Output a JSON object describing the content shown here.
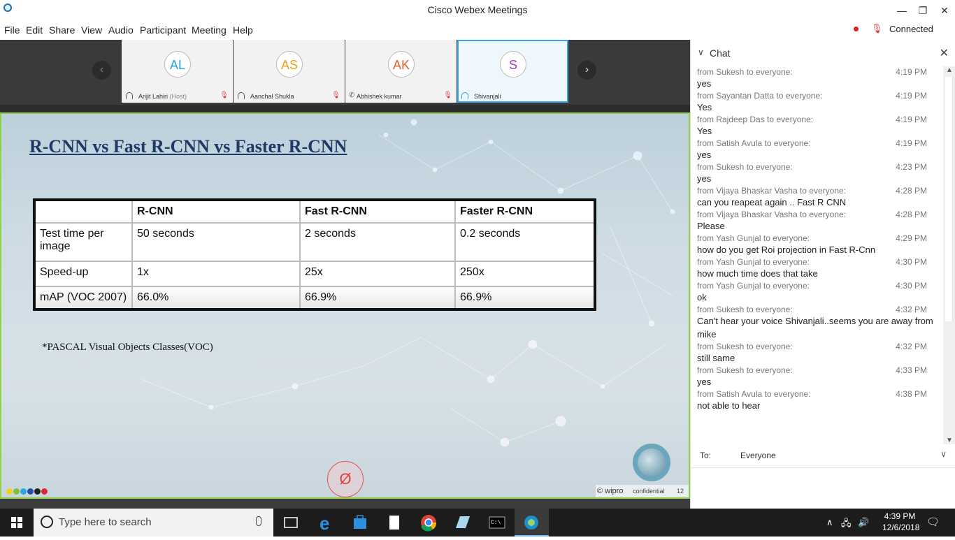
{
  "window": {
    "title": "Cisco Webex Meetings",
    "minimize": "—",
    "restore": "❐",
    "close": "✕"
  },
  "menu": [
    "File",
    "Edit",
    "Share",
    "View",
    "Audio",
    "Participant",
    "Meeting",
    "Help"
  ],
  "status": {
    "connection": "Connected",
    "recording_color": "#e02020"
  },
  "participants": [
    {
      "initials": "AL",
      "name": "Arijit Lahiri",
      "role": "(Host)",
      "color": "#2a9fd8"
    },
    {
      "initials": "AS",
      "name": "Aanchal Shukla",
      "role": "",
      "color": "#e8a21a"
    },
    {
      "initials": "AK",
      "name": "Abhishek kumar",
      "role": "",
      "color": "#e0612a"
    },
    {
      "initials": "S",
      "name": "Shivanjali",
      "role": "",
      "color": "#9b3fb5"
    }
  ],
  "slide": {
    "title": "R-CNN vs Fast R-CNN vs Faster R-CNN",
    "table": {
      "headers": [
        "",
        "R-CNN",
        "Fast R-CNN",
        "Faster R-CNN"
      ],
      "rows": [
        [
          "Test time per image",
          "50 seconds",
          "2 seconds",
          "0.2 seconds"
        ],
        [
          "Speed-up",
          "1x",
          "25x",
          "250x"
        ],
        [
          "mAP (VOC 2007)",
          "66.0%",
          "66.9%",
          "66.9%"
        ]
      ]
    },
    "note": "*PASCAL Visual Objects Classes(VOC)",
    "footer_brand": "© wipro",
    "footer_label": "confidential",
    "page_number": "12"
  },
  "chat": {
    "title": "Chat",
    "to_label": "To:",
    "to_value": "Everyone",
    "messages": [
      {
        "from": "from Sukesh to everyone:",
        "time": "4:19 PM",
        "text": "yes"
      },
      {
        "from": "from Sayantan Datta to everyone:",
        "time": "4:19 PM",
        "text": "Yes"
      },
      {
        "from": "from Rajdeep Das to everyone:",
        "time": "4:19 PM",
        "text": "Yes"
      },
      {
        "from": "from Satish Avula to everyone:",
        "time": "4:19 PM",
        "text": "yes"
      },
      {
        "from": "from Sukesh to everyone:",
        "time": "4:23 PM",
        "text": "yes"
      },
      {
        "from": "from Vijaya Bhaskar Vasha to everyone:",
        "time": "4:28 PM",
        "text": "can you reapeat again .. Fast R CNN"
      },
      {
        "from": "from Vijaya Bhaskar Vasha to everyone:",
        "time": "4:28 PM",
        "text": "Please"
      },
      {
        "from": "from Yash Gunjal to everyone:",
        "time": "4:29 PM",
        "text": "how do you get Roi projection in Fast R-Cnn"
      },
      {
        "from": "from Yash Gunjal to everyone:",
        "time": "4:30 PM",
        "text": "how much time does that take"
      },
      {
        "from": "from Yash Gunjal to everyone:",
        "time": "4:30 PM",
        "text": "ok"
      },
      {
        "from": "from Sukesh to everyone:",
        "time": "4:32 PM",
        "text": "Can't hear your voice Shivanjali..seems you are away from mike"
      },
      {
        "from": "from Sukesh to everyone:",
        "time": "4:32 PM",
        "text": "still same"
      },
      {
        "from": "from Sukesh to everyone:",
        "time": "4:33 PM",
        "text": "yes"
      },
      {
        "from": "from Satish Avula to everyone:",
        "time": "4:38 PM",
        "text": "not able to hear"
      }
    ]
  },
  "taskbar": {
    "search_placeholder": "Type here to search",
    "time": "4:39 PM",
    "date": "12/6/2018"
  }
}
